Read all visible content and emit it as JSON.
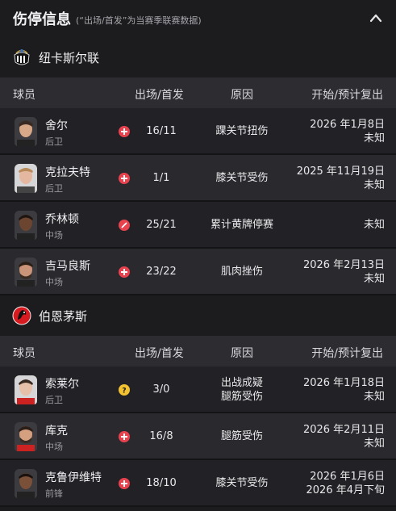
{
  "header": {
    "title": "伤停信息",
    "subtitle": "(“出场/首发”为当赛季联赛数据)"
  },
  "table_headers": {
    "player": "球员",
    "apps": "出场/首发",
    "reason": "原因",
    "return": "开始/预计复出"
  },
  "teams": [
    {
      "name": "纽卡斯尔联",
      "logo_icon": "newcastle-crest-icon",
      "players": [
        {
          "name": "舍尔",
          "position": "后卫",
          "status_icon": "injury-cross-icon",
          "apps": "16/11",
          "reason": [
            "踝关节扭伤"
          ],
          "return": [
            "2026 年1月8日",
            "未知"
          ]
        },
        {
          "name": "克拉夫特",
          "position": "后卫",
          "status_icon": "injury-cross-icon",
          "apps": "1/1",
          "reason": [
            "膝关节受伤"
          ],
          "return": [
            "2025 年11月19日",
            "未知"
          ]
        },
        {
          "name": "乔林顿",
          "position": "中场",
          "status_icon": "suspension-card-icon",
          "apps": "25/21",
          "reason": [
            "累计黄牌停赛"
          ],
          "return": [
            "未知"
          ]
        },
        {
          "name": "吉马良斯",
          "position": "中场",
          "status_icon": "injury-cross-icon",
          "apps": "23/22",
          "reason": [
            "肌肉挫伤"
          ],
          "return": [
            "2026 年2月13日",
            "未知"
          ]
        }
      ]
    },
    {
      "name": "伯恩茅斯",
      "logo_icon": "bournemouth-crest-icon",
      "players": [
        {
          "name": "索莱尔",
          "position": "后卫",
          "status_icon": "doubtful-question-icon",
          "apps": "3/0",
          "reason": [
            "出战成疑",
            "腿筋受伤"
          ],
          "return": [
            "2026 年1月18日",
            "未知"
          ]
        },
        {
          "name": "库克",
          "position": "中场",
          "status_icon": "injury-cross-icon",
          "apps": "16/8",
          "reason": [
            "腿筋受伤"
          ],
          "return": [
            "2026 年2月11日",
            "未知"
          ]
        },
        {
          "name": "克鲁伊维特",
          "position": "前锋",
          "status_icon": "injury-cross-icon",
          "apps": "18/10",
          "reason": [
            "膝关节受伤"
          ],
          "return": [
            "2026 年1月6日",
            "2026 年4月下旬"
          ]
        }
      ]
    }
  ],
  "colors": {
    "background": "#1c1c1f",
    "header_row": "#2d2d31",
    "injury_red": "#e8424f",
    "doubt_yellow": "#f2c230"
  }
}
